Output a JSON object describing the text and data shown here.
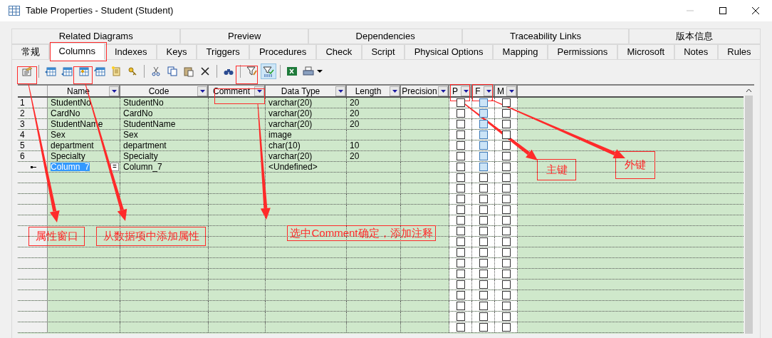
{
  "window": {
    "title": "Table Properties - Student (Student)"
  },
  "tab_rows": [
    [
      {
        "label": "Related Diagrams",
        "selected": false
      },
      {
        "label": "Preview",
        "selected": false
      },
      {
        "label": "Dependencies",
        "selected": false
      },
      {
        "label": "Traceability Links",
        "selected": false
      },
      {
        "label": "版本信息",
        "selected": false
      }
    ],
    [
      {
        "label": "常规",
        "selected": false
      },
      {
        "label": "Columns",
        "selected": true
      },
      {
        "label": "Indexes",
        "selected": false
      },
      {
        "label": "Keys",
        "selected": false
      },
      {
        "label": "Triggers",
        "selected": false
      },
      {
        "label": "Procedures",
        "selected": false
      },
      {
        "label": "Check",
        "selected": false
      },
      {
        "label": "Script",
        "selected": false
      },
      {
        "label": "Physical Options",
        "selected": false
      },
      {
        "label": "Mapping",
        "selected": false
      },
      {
        "label": "Permissions",
        "selected": false
      },
      {
        "label": "Microsoft",
        "selected": false
      },
      {
        "label": "Notes",
        "selected": false
      },
      {
        "label": "Rules",
        "selected": false
      }
    ]
  ],
  "grid": {
    "columns": [
      "Name",
      "Code",
      "Comment",
      "Data Type",
      "Length",
      "Precision",
      "P",
      "F",
      "M"
    ],
    "rows": [
      {
        "number": "1",
        "name": "StudentNo",
        "code": "StudentNo",
        "comment": "",
        "data_type": "varchar(20)",
        "length": "20",
        "precision": "",
        "p": false,
        "f": false,
        "m": false,
        "f_shaded": true,
        "selected": false
      },
      {
        "number": "2",
        "name": "CardNo",
        "code": "CardNo",
        "comment": "",
        "data_type": "varchar(20)",
        "length": "20",
        "precision": "",
        "p": false,
        "f": false,
        "m": false,
        "f_shaded": true,
        "selected": false
      },
      {
        "number": "3",
        "name": "StudentName",
        "code": "StudentName",
        "comment": "",
        "data_type": "varchar(20)",
        "length": "20",
        "precision": "",
        "p": false,
        "f": false,
        "m": false,
        "f_shaded": true,
        "selected": false
      },
      {
        "number": "4",
        "name": "Sex",
        "code": "Sex",
        "comment": "",
        "data_type": "image",
        "length": "",
        "precision": "",
        "p": false,
        "f": false,
        "m": false,
        "f_shaded": true,
        "selected": false
      },
      {
        "number": "5",
        "name": "department",
        "code": "department",
        "comment": "",
        "data_type": "char(10)",
        "length": "10",
        "precision": "",
        "p": false,
        "f": false,
        "m": false,
        "f_shaded": true,
        "selected": false
      },
      {
        "number": "6",
        "name": "Specialty",
        "code": "Specialty",
        "comment": "",
        "data_type": "varchar(20)",
        "length": "20",
        "precision": "",
        "p": false,
        "f": false,
        "m": false,
        "f_shaded": true,
        "selected": false
      },
      {
        "number": "",
        "name": "Column_7",
        "code": "Column_7",
        "comment": "",
        "data_type": "<Undefined>",
        "length": "",
        "precision": "",
        "p": false,
        "f": false,
        "m": false,
        "f_shaded": true,
        "selected": true,
        "edit_button": "="
      }
    ]
  },
  "empty_rows": [
    {
      "p": false,
      "f": false,
      "m": false
    },
    {
      "p": false,
      "f": false,
      "m": false
    },
    {
      "p": false,
      "f": false,
      "m": false
    },
    {
      "p": false,
      "f": false,
      "m": false
    },
    {
      "p": false,
      "f": false,
      "m": false
    },
    {
      "p": false,
      "f": false,
      "m": false
    },
    {
      "p": false,
      "f": false,
      "m": false
    },
    {
      "p": false,
      "f": false,
      "m": false
    },
    {
      "p": false,
      "f": false,
      "m": false
    },
    {
      "p": false,
      "f": false,
      "m": false
    },
    {
      "p": false,
      "f": false,
      "m": false
    },
    {
      "p": false,
      "f": false,
      "m": false
    },
    {
      "p": false,
      "f": false,
      "m": false
    },
    {
      "p": false,
      "f": false,
      "m": false
    },
    {
      "p": false,
      "f": false,
      "m": false
    }
  ],
  "annotations": [
    {
      "text": "属性窗口"
    },
    {
      "text": "从数据项中添加属性"
    },
    {
      "text": "选中Comment确定，添加注释"
    },
    {
      "text": "主键"
    },
    {
      "text": "外键"
    }
  ]
}
